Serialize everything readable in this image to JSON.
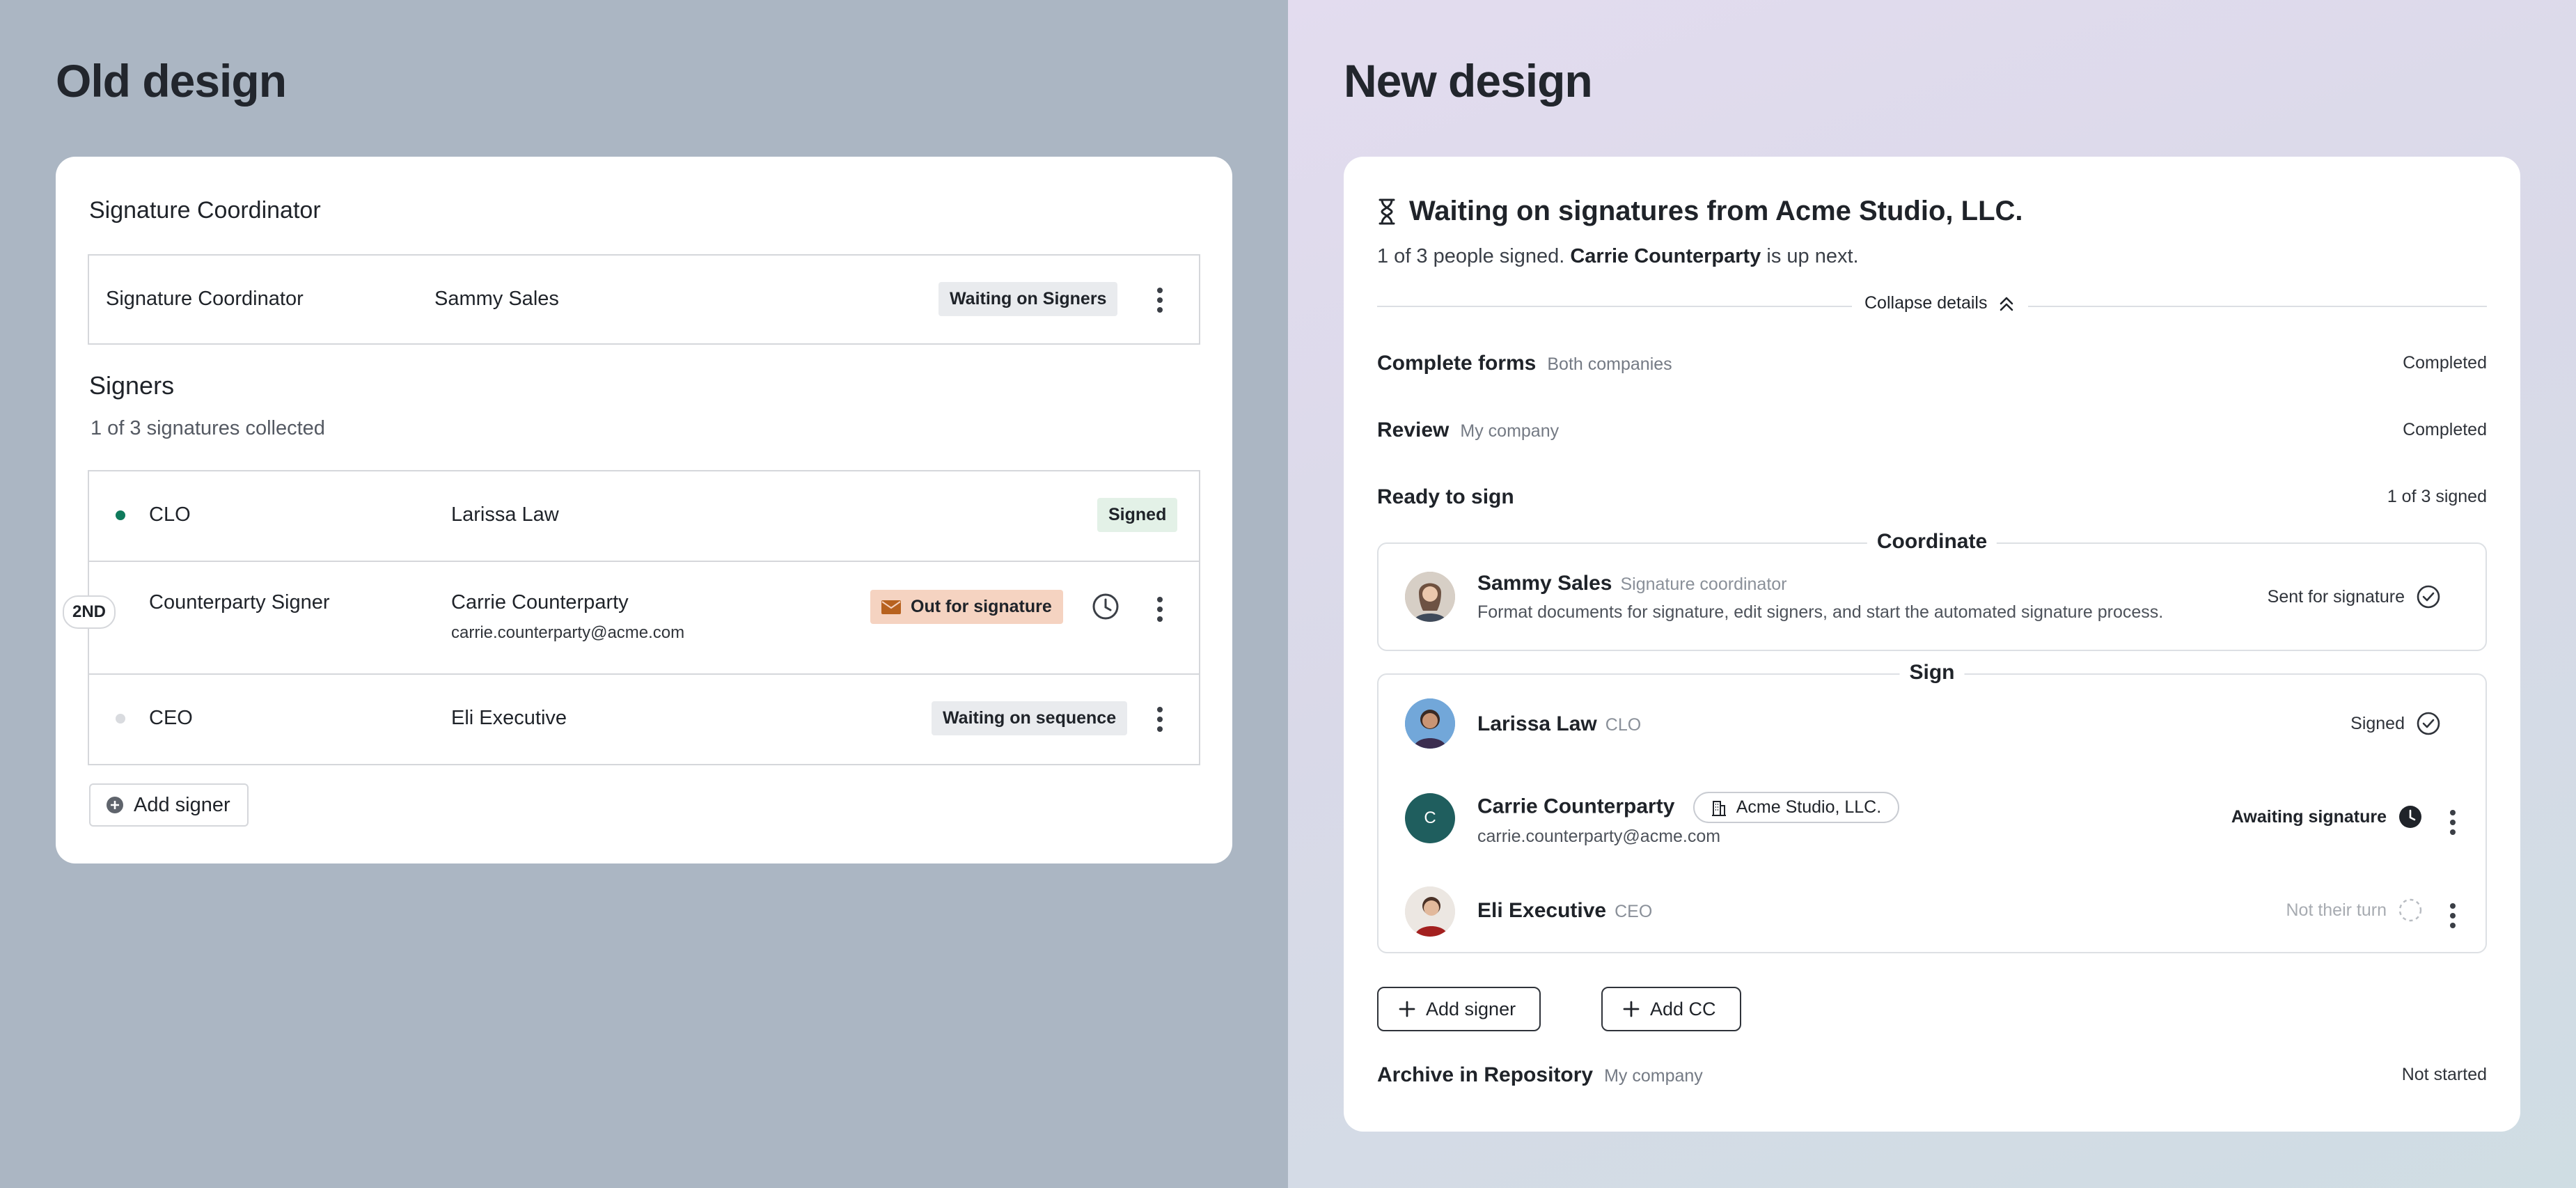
{
  "old": {
    "heading": "Old design",
    "card_title": "Signature Coordinator",
    "coordinator": {
      "role": "Signature Coordinator",
      "name": "Sammy Sales",
      "status": "Waiting on Signers"
    },
    "signers_title": "Signers",
    "signers_sub": "1 of 3 signatures collected",
    "signers": [
      {
        "role": "CLO",
        "name": "Larissa Law",
        "email": "",
        "status": "Signed"
      },
      {
        "role": "Counterparty Signer",
        "name": "Carrie Counterparty",
        "email": "carrie.counterparty@acme.com",
        "status": "Out for signature",
        "order": "2ND"
      },
      {
        "role": "CEO",
        "name": "Eli Executive",
        "email": "",
        "status": "Waiting on sequence"
      }
    ],
    "add_signer": "Add signer"
  },
  "new": {
    "heading": "New design",
    "title": "Waiting on signatures from Acme Studio, LLC.",
    "sub_prefix": "1 of 3 people signed.",
    "sub_name": "Carrie Counterparty",
    "sub_suffix": "is up next.",
    "collapse": "Collapse details",
    "steps": [
      {
        "title": "Complete forms",
        "sub": "Both companies",
        "status": "Completed"
      },
      {
        "title": "Review",
        "sub": "My company",
        "status": "Completed"
      },
      {
        "title": "Ready to sign",
        "sub": "",
        "status": "1 of 3 signed"
      },
      {
        "title": "Archive in Repository",
        "sub": "My company",
        "status": "Not started"
      }
    ],
    "coordinate": {
      "label": "Coordinate",
      "name": "Sammy Sales",
      "role": "Signature coordinator",
      "desc": "Format documents for signature, edit signers, and start the automated signature process.",
      "status": "Sent for signature"
    },
    "sign": {
      "label": "Sign",
      "people": [
        {
          "name": "Larissa Law",
          "role": "CLO",
          "status": "Signed"
        },
        {
          "name": "Carrie Counterparty",
          "company": "Acme Studio, LLC.",
          "email": "carrie.counterparty@acme.com",
          "status": "Awaiting signature",
          "initial": "C"
        },
        {
          "name": "Eli Executive",
          "role": "CEO",
          "status": "Not their turn"
        }
      ]
    },
    "add_signer": "Add signer",
    "add_cc": "Add CC"
  },
  "colors": {
    "left_bg": "#abb6c3",
    "signed_dot": "#0f7a5c",
    "out_tag_bg": "#f5d3c1",
    "carrie_avatar": "#1f5e5e"
  }
}
